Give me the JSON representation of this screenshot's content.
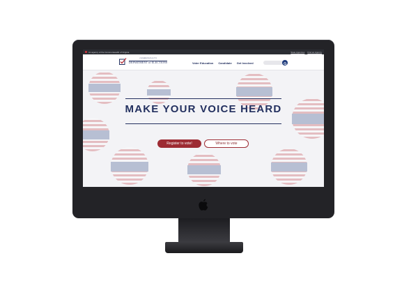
{
  "agency_bar": {
    "text": "An agency of the Commonwealth of Virginia",
    "links": [
      "State Agencies",
      "Find an Agency"
    ]
  },
  "logo": {
    "small": "COMMONWEALTH",
    "big": "DEPARTMENT of ELECTIONS",
    "icon": "checkmark-ballot-icon"
  },
  "nav": {
    "links": [
      "Voter Education",
      "Candidate",
      "Get Involved"
    ],
    "search_placeholder": ""
  },
  "hero": {
    "headline": "MAKE YOUR VOICE HEARD",
    "buttons": [
      "Register to vote!",
      "Where to vote"
    ]
  },
  "colors": {
    "navy": "#23305f",
    "accent_red": "#9d2b33",
    "monitor_bezel": "#232327"
  },
  "icons": {
    "search": "search-icon",
    "device": "apple-logo-icon"
  }
}
